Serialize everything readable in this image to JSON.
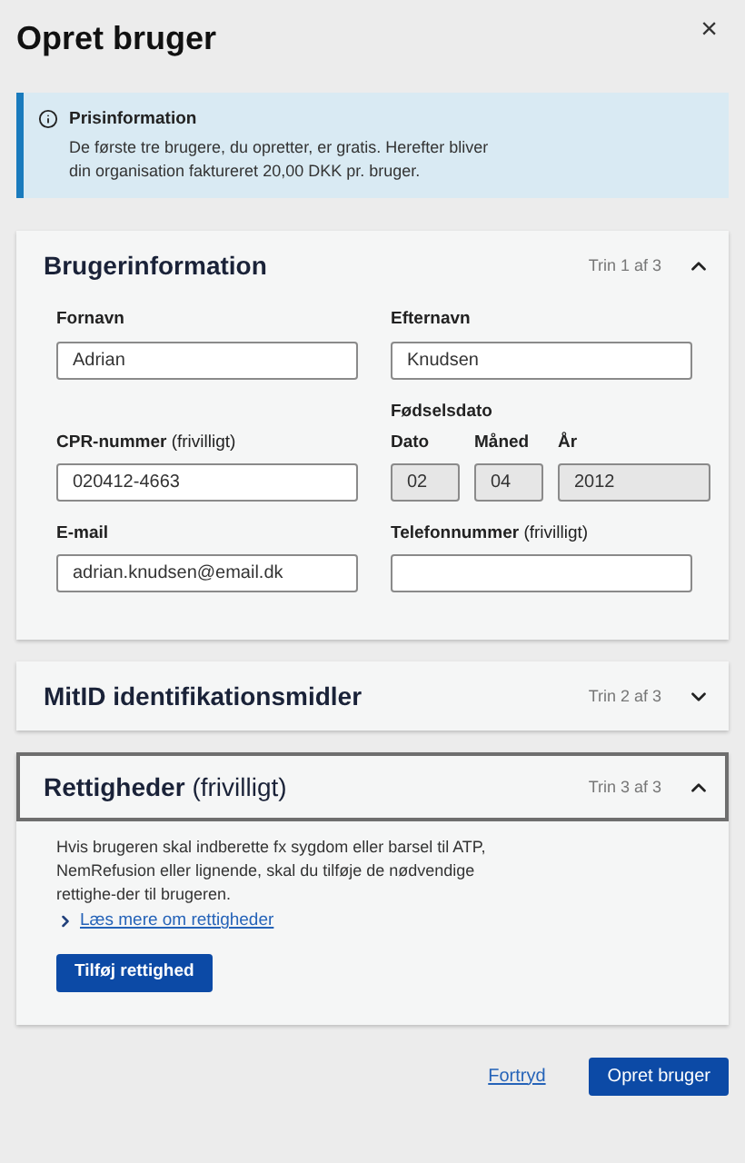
{
  "dialog": {
    "title": "Opret bruger",
    "close_label": "×"
  },
  "info": {
    "title": "Prisinformation",
    "text": "De første tre brugere, du opretter, er gratis. Herefter bliver din organisation faktureret 20,00 DKK pr. bruger."
  },
  "sections": [
    {
      "kind": "form",
      "title": "Brugerinformation",
      "step": "Trin 1 af 3",
      "expanded": true,
      "focused": false,
      "rows": [
        [
          {
            "kind": "field",
            "label": "Fornavn",
            "value": "Adrian",
            "disabled": false
          },
          {
            "kind": "field",
            "label": "Efternavn",
            "value": "Knudsen",
            "disabled": false
          }
        ],
        [
          {
            "kind": "field",
            "label": "CPR-nummer",
            "suffix": "(frivilligt)",
            "value": "020412-4663",
            "disabled": false
          },
          {
            "kind": "date",
            "label": "Fødselsdato",
            "parts": [
              {
                "label": "Dato",
                "value": "02",
                "disabled": true
              },
              {
                "label": "Måned",
                "value": "04",
                "disabled": true
              },
              {
                "label": "År",
                "value": "2012",
                "disabled": true
              }
            ]
          }
        ],
        [
          {
            "kind": "field",
            "label": "E-mail",
            "value": "adrian.knudsen@email.dk",
            "disabled": false
          },
          {
            "kind": "field",
            "label": "Telefonnummer",
            "suffix": "(frivilligt)",
            "disabled": false
          }
        ]
      ]
    },
    {
      "title": "MitID identifikationsmidler",
      "step": "Trin 2 af 3",
      "expanded": false,
      "focused": false
    },
    {
      "kind": "text",
      "title": "Rettigheder",
      "suffix": "(frivilligt)",
      "step": "Trin 3 af 3",
      "expanded": true,
      "focused": true,
      "text": "Hvis brugeren skal indberette fx sygdom eller barsel til ATP, NemRefusion eller lignende, skal du tilføje de nødvendige rettighe-der til brugeren.",
      "link": "Læs mere om rettigheder",
      "button": "Tilføj rettighed"
    }
  ],
  "footer": {
    "cancel": "Fortryd",
    "submit": "Opret bruger"
  }
}
